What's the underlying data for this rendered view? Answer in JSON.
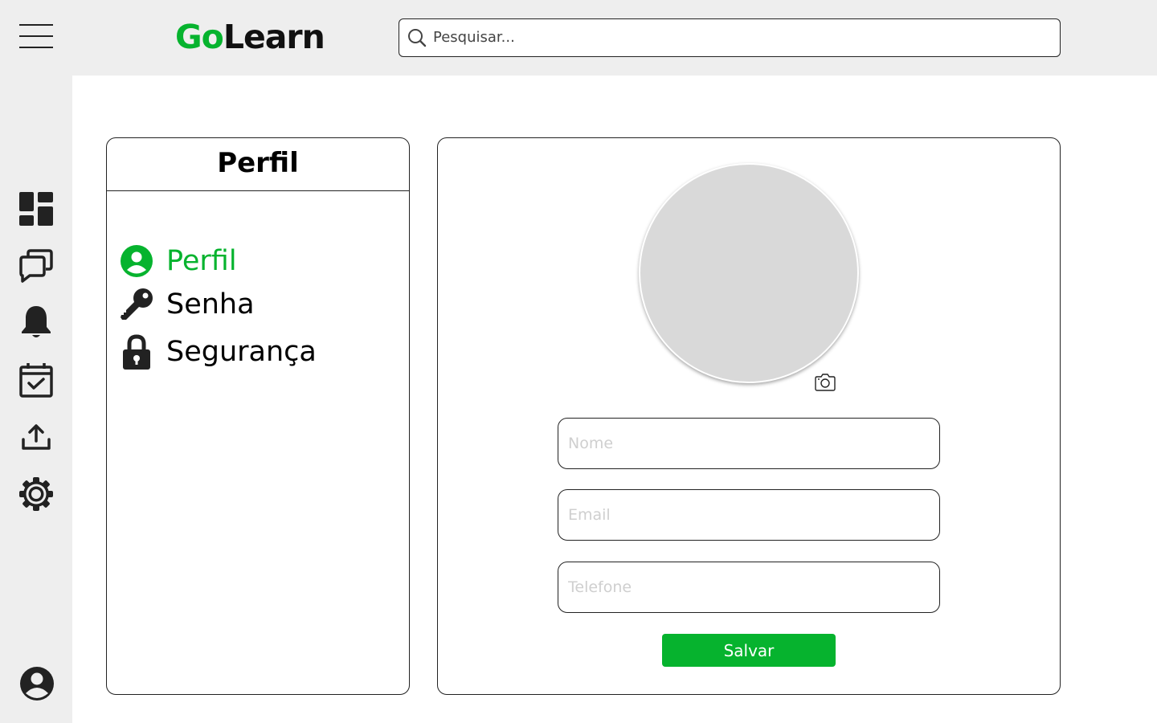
{
  "colors": {
    "accent": "#06b32e",
    "chrome": "#eeeeee"
  },
  "header": {
    "menu_icon": "hamburger-menu-icon",
    "logo": {
      "part1": "Go",
      "part2": "Learn"
    },
    "search": {
      "placeholder": "Pesquisar...",
      "icon": "search-icon"
    }
  },
  "sidebar": {
    "items": [
      {
        "icon": "dashboard-icon"
      },
      {
        "icon": "chat-icon"
      },
      {
        "icon": "bell-icon"
      },
      {
        "icon": "calendar-check-icon"
      },
      {
        "icon": "upload-icon"
      },
      {
        "icon": "gear-icon"
      }
    ],
    "account_icon": "account-icon"
  },
  "settings_menu": {
    "title": "Perfil",
    "items": [
      {
        "label": "Perfil",
        "icon": "user-circle-icon",
        "active": true
      },
      {
        "label": "Senha",
        "icon": "key-icon",
        "active": false
      },
      {
        "label": "Segurança",
        "icon": "lock-icon",
        "active": false
      }
    ]
  },
  "profile_form": {
    "camera_icon": "camera-icon",
    "fields": [
      {
        "placeholder": "Nome",
        "value": ""
      },
      {
        "placeholder": "Email",
        "value": ""
      },
      {
        "placeholder": "Telefone",
        "value": ""
      }
    ],
    "save_label": "Salvar"
  }
}
